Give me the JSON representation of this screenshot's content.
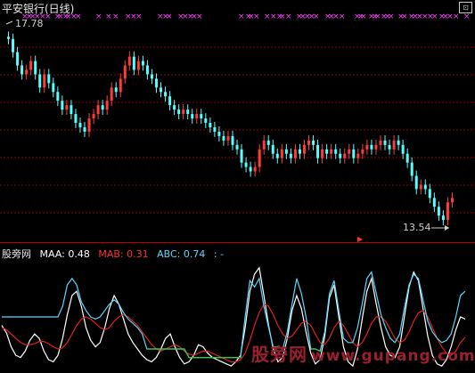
{
  "title": "平安银行(日线)",
  "price_high_label": "17.78",
  "price_low_label": "13.54",
  "indicator": {
    "name": "股旁网",
    "maa_label": "MAA: 0.48",
    "mab_label": "MAB: 0.31",
    "abc_label": "ABC: 0.74",
    "extra": ": -"
  },
  "watermark": {
    "text": "股旁网",
    "url": "www.gupang.com"
  },
  "colors": {
    "up": "#ff3c3c",
    "down": "#54ffff",
    "grid": "#8b0000",
    "maa": "#ffffff",
    "mab": "#e02020",
    "abc": "#58d8ff",
    "green": "#30d030",
    "signal": "#ff40ff"
  },
  "chart_data": [
    {
      "type": "candlestick",
      "title": "平安银行(日线)",
      "ylim": [
        13.3,
        18.3
      ],
      "max_label": 17.78,
      "min_label": 13.54,
      "closes": [
        17.7,
        17.4,
        17.1,
        16.9,
        17.0,
        17.2,
        16.9,
        16.6,
        16.9,
        16.7,
        16.5,
        16.3,
        16.1,
        16.2,
        16.0,
        15.8,
        15.7,
        15.6,
        15.9,
        16.0,
        16.2,
        16.1,
        16.3,
        16.6,
        16.5,
        16.8,
        17.1,
        17.3,
        17.0,
        17.2,
        17.1,
        16.9,
        16.8,
        16.6,
        16.5,
        16.4,
        16.2,
        16.1,
        16.0,
        16.1,
        16.0,
        15.9,
        16.0,
        15.9,
        15.8,
        15.7,
        15.6,
        15.5,
        15.4,
        15.5,
        15.3,
        15.2,
        14.9,
        14.8,
        14.7,
        14.8,
        15.2,
        15.4,
        15.3,
        15.1,
        15.0,
        15.2,
        15.1,
        15.0,
        15.2,
        15.1,
        15.3,
        15.4,
        15.3,
        15.0,
        15.2,
        15.1,
        15.2,
        15.1,
        15.0,
        15.1,
        15.2,
        15.0,
        15.1,
        15.2,
        15.3,
        15.2,
        15.3,
        15.4,
        15.3,
        15.2,
        15.4,
        15.3,
        15.1,
        14.9,
        14.6,
        14.3,
        14.4,
        14.3,
        14.1,
        13.9,
        13.7,
        13.6,
        14.0,
        14.1
      ]
    },
    {
      "type": "line",
      "series": [
        {
          "name": "MAA",
          "values": [
            0.42,
            0.35,
            0.22,
            0.14,
            0.12,
            0.18,
            0.28,
            0.34,
            0.3,
            0.18,
            0.1,
            0.08,
            0.14,
            0.3,
            0.52,
            0.7,
            0.74,
            0.6,
            0.4,
            0.28,
            0.22,
            0.26,
            0.4,
            0.58,
            0.7,
            0.62,
            0.48,
            0.34,
            0.26,
            0.2,
            0.14,
            0.1,
            0.08,
            0.12,
            0.2,
            0.3,
            0.34,
            0.22,
            0.12,
            0.06,
            0.08,
            0.14,
            0.24,
            0.22,
            0.16,
            0.12,
            0.1,
            0.08,
            0.06,
            0.04,
            0.08,
            0.14,
            0.4,
            0.74,
            0.9,
            0.96,
            0.7,
            0.42,
            0.2,
            0.08,
            0.12,
            0.3,
            0.56,
            0.7,
            0.58,
            0.36,
            0.16,
            0.06,
            0.1,
            0.32,
            0.68,
            0.8,
            0.5,
            0.22,
            0.08,
            0.04,
            0.2,
            0.48,
            0.74,
            0.86,
            0.62,
            0.4,
            0.22,
            0.14,
            0.12,
            0.22,
            0.5,
            0.78,
            0.92,
            0.84,
            0.58,
            0.32,
            0.14,
            0.06,
            0.04,
            0.1,
            0.22,
            0.38,
            0.5,
            0.48
          ]
        },
        {
          "name": "MAB",
          "values": [
            0.4,
            0.38,
            0.34,
            0.3,
            0.26,
            0.24,
            0.24,
            0.25,
            0.27,
            0.27,
            0.25,
            0.22,
            0.2,
            0.21,
            0.26,
            0.34,
            0.42,
            0.48,
            0.5,
            0.48,
            0.44,
            0.4,
            0.38,
            0.4,
            0.46,
            0.5,
            0.52,
            0.5,
            0.46,
            0.42,
            0.36,
            0.3,
            0.24,
            0.2,
            0.18,
            0.2,
            0.22,
            0.24,
            0.22,
            0.18,
            0.15,
            0.14,
            0.16,
            0.18,
            0.18,
            0.16,
            0.14,
            0.12,
            0.1,
            0.08,
            0.08,
            0.1,
            0.16,
            0.28,
            0.42,
            0.54,
            0.62,
            0.6,
            0.52,
            0.42,
            0.34,
            0.3,
            0.32,
            0.38,
            0.44,
            0.46,
            0.42,
            0.34,
            0.26,
            0.24,
            0.3,
            0.4,
            0.46,
            0.42,
            0.34,
            0.26,
            0.22,
            0.26,
            0.34,
            0.44,
            0.5,
            0.5,
            0.46,
            0.38,
            0.3,
            0.26,
            0.28,
            0.36,
            0.46,
            0.54,
            0.56,
            0.5,
            0.4,
            0.3,
            0.22,
            0.16,
            0.14,
            0.18,
            0.26,
            0.31
          ]
        },
        {
          "name": "ABC",
          "values": [
            0.5,
            0.5,
            0.5,
            0.5,
            0.5,
            0.5,
            0.5,
            0.5,
            0.5,
            0.5,
            0.5,
            0.5,
            0.5,
            0.6,
            0.8,
            0.86,
            0.8,
            0.64,
            0.56,
            0.5,
            0.48,
            0.5,
            0.56,
            0.62,
            0.66,
            0.62,
            0.54,
            0.48,
            0.44,
            0.4,
            0.34,
            0.2,
            0.2,
            0.2,
            0.2,
            0.2,
            0.2,
            0.2,
            0.2,
            0.2,
            0.12,
            0.12,
            0.12,
            0.12,
            0.12,
            0.12,
            0.12,
            0.12,
            0.12,
            0.12,
            0.12,
            0.12,
            0.5,
            0.84,
            0.78,
            0.86,
            0.6,
            0.4,
            0.22,
            0.22,
            0.2,
            0.36,
            0.62,
            0.86,
            0.72,
            0.5,
            0.2,
            0.2,
            0.18,
            0.36,
            0.72,
            0.84,
            0.56,
            0.3,
            0.26,
            0.26,
            0.4,
            0.62,
            0.86,
            0.92,
            0.72,
            0.52,
            0.4,
            0.3,
            0.26,
            0.34,
            0.58,
            0.8,
            0.9,
            0.86,
            0.66,
            0.46,
            0.36,
            0.3,
            0.26,
            0.28,
            0.34,
            0.5,
            0.7,
            0.74
          ]
        }
      ],
      "ylim": [
        0,
        1
      ]
    }
  ]
}
